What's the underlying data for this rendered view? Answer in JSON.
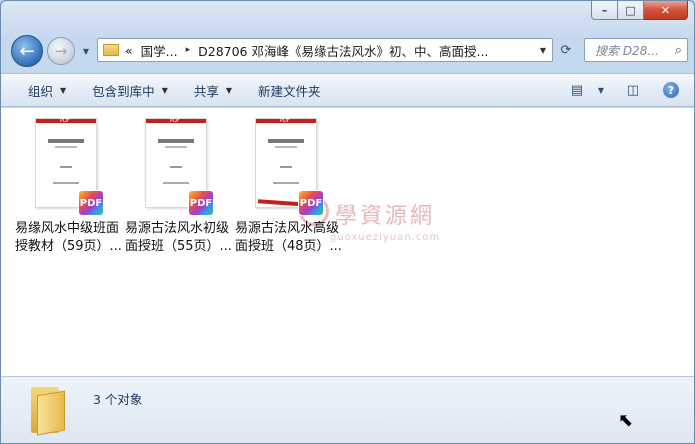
{
  "window": {
    "caption_min": "–",
    "caption_max": "□",
    "caption_close": "✕"
  },
  "nav": {
    "back_glyph": "←",
    "forward_glyph": "→",
    "history_glyph": "▼"
  },
  "address": {
    "chevron": "«",
    "segments": [
      "国学...",
      "D28706 邓海峰《易缘古法风水》初、中、高面授..."
    ],
    "separator": "▸",
    "dropdown_glyph": "▼",
    "refresh_glyph": "⟳"
  },
  "search": {
    "placeholder": "搜索 D28...",
    "icon_glyph": "⌕"
  },
  "toolbar": {
    "items": [
      {
        "label": "组织",
        "caret": "▼"
      },
      {
        "label": "包含到库中",
        "caret": "▼"
      },
      {
        "label": "共享",
        "caret": "▼"
      },
      {
        "label": "新建文件夹",
        "caret": ""
      }
    ],
    "view_glyph": "▤",
    "view_caret": "▼",
    "pane_glyph": "◫",
    "help_glyph": "?"
  },
  "files": [
    {
      "line1": "易缘风水中级班面",
      "line2": "授教材（59页）...",
      "thumb_title": "PDF",
      "badge": "PDF"
    },
    {
      "line1": "易源古法风水初级",
      "line2": "面授班（55页）...",
      "thumb_title": "PDF",
      "badge": "PDF"
    },
    {
      "line1": "易源古法风水高级",
      "line2": "面授班（48页）...",
      "thumb_title": "PDF",
      "badge": "PDF"
    }
  ],
  "watermark": {
    "text": "學資源網",
    "sub": "guoxueziyuan.com"
  },
  "details": {
    "count_text": "3 个对象"
  },
  "cursor_glyph": "⬉"
}
